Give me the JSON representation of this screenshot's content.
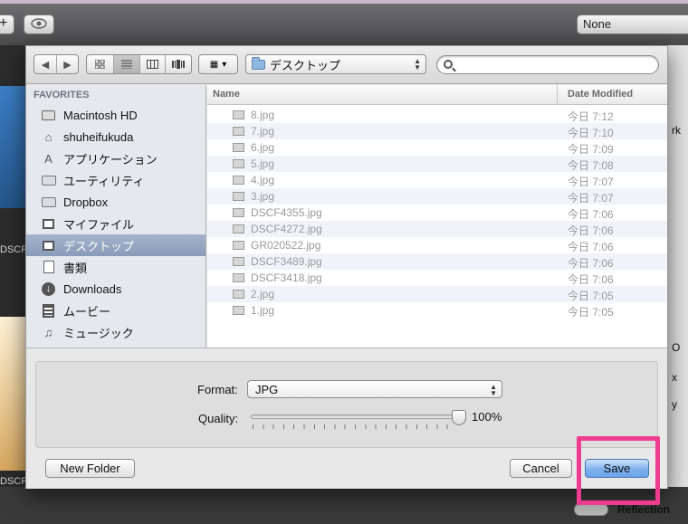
{
  "background": {
    "none_label": "None",
    "left_labels": [
      "DSCF",
      "DSCF"
    ],
    "side_labels": [
      "rk",
      "O",
      "x",
      "y"
    ],
    "reflection_label": "Reflection"
  },
  "toolbar": {
    "location": "デスクトップ",
    "search_placeholder": ""
  },
  "sidebar": {
    "header": "FAVORITES",
    "items": [
      {
        "label": "Macintosh HD",
        "icon": "hard-drive-icon"
      },
      {
        "label": "shuheifukuda",
        "icon": "home-icon"
      },
      {
        "label": "アプリケーション",
        "icon": "applications-icon"
      },
      {
        "label": "ユーティリティ",
        "icon": "folder-icon"
      },
      {
        "label": "Dropbox",
        "icon": "folder-icon"
      },
      {
        "label": "マイファイル",
        "icon": "all-files-icon"
      },
      {
        "label": "デスクトップ",
        "icon": "desktop-icon",
        "selected": true
      },
      {
        "label": "書類",
        "icon": "documents-icon"
      },
      {
        "label": "Downloads",
        "icon": "downloads-icon"
      },
      {
        "label": "ムービー",
        "icon": "movies-icon"
      },
      {
        "label": "ミュージック",
        "icon": "music-icon"
      }
    ]
  },
  "file_list": {
    "columns": {
      "name": "Name",
      "date": "Date Modified"
    },
    "rows": [
      {
        "name": "8.jpg",
        "date": "今日 7:12"
      },
      {
        "name": "7.jpg",
        "date": "今日 7:10"
      },
      {
        "name": "6.jpg",
        "date": "今日 7:09"
      },
      {
        "name": "5.jpg",
        "date": "今日 7:08"
      },
      {
        "name": "4.jpg",
        "date": "今日 7:07"
      },
      {
        "name": "3.jpg",
        "date": "今日 7:07"
      },
      {
        "name": "DSCF4355.jpg",
        "date": "今日 7:06"
      },
      {
        "name": "DSCF4272.jpg",
        "date": "今日 7:06"
      },
      {
        "name": "GR020522.jpg",
        "date": "今日 7:06"
      },
      {
        "name": "DSCF3489.jpg",
        "date": "今日 7:06"
      },
      {
        "name": "DSCF3418.jpg",
        "date": "今日 7:06"
      },
      {
        "name": "2.jpg",
        "date": "今日 7:05"
      },
      {
        "name": "1.jpg",
        "date": "今日 7:05"
      }
    ]
  },
  "options": {
    "format_label": "Format:",
    "format_value": "JPG",
    "quality_label": "Quality:",
    "quality_value": "100%",
    "quality_fraction": 1.0
  },
  "buttons": {
    "new_folder": "New Folder",
    "cancel": "Cancel",
    "save": "Save"
  },
  "colors": {
    "highlight": "#ee3c8f",
    "selection": "#8a9cb9",
    "save_button": "#6aa4ea"
  }
}
